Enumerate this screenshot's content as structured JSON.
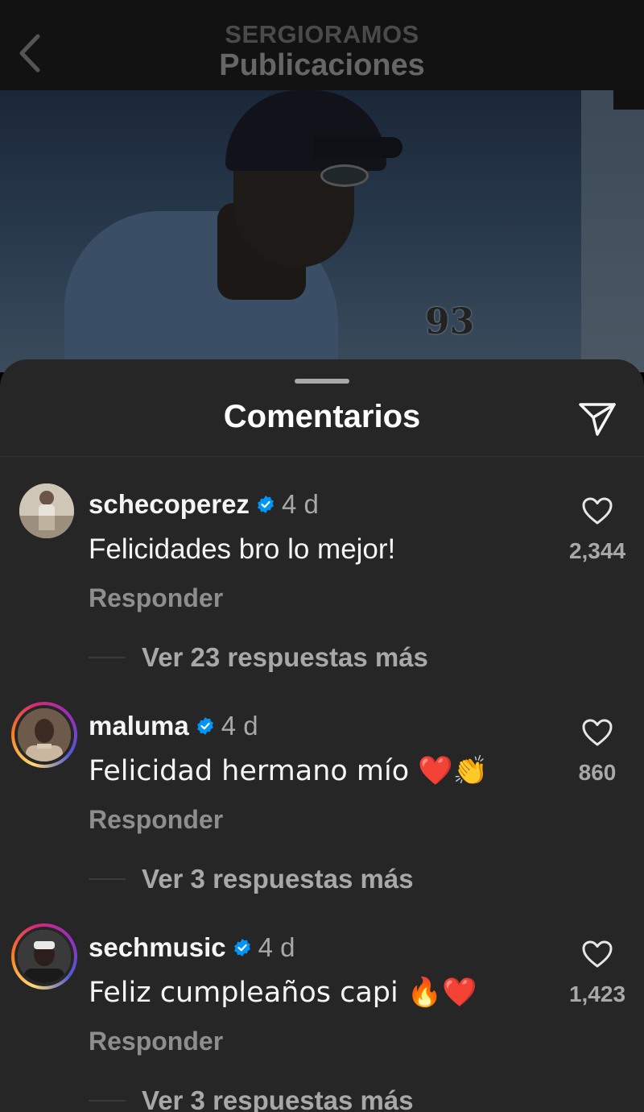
{
  "header": {
    "username": "SERGIORAMOS",
    "title": "Publicaciones",
    "back_icon": "chevron-left-icon"
  },
  "sheet": {
    "title": "Comentarios",
    "share_icon": "paper-plane-icon"
  },
  "comments": [
    {
      "username": "schecoperez",
      "verified": true,
      "time": "4 d",
      "text": "Felicidades bro lo mejor!",
      "reply_label": "Responder",
      "more_replies": "Ver 23 respuestas más",
      "likes": "2,344"
    },
    {
      "username": "maluma",
      "verified": true,
      "time": "4 d",
      "text": "Felicidad hermano mío ❤️👏",
      "reply_label": "Responder",
      "more_replies": "Ver 3 respuestas más",
      "likes": "860"
    },
    {
      "username": "sechmusic",
      "verified": true,
      "time": "4 d",
      "text": "Feliz cumpleaños capi 🔥❤️",
      "reply_label": "Responder",
      "more_replies": "Ver 3 respuestas más",
      "likes": "1,423"
    }
  ],
  "post_image": {
    "cake_topper": "93"
  },
  "colors": {
    "sheet_bg": "#262626",
    "verified_blue": "#0095f6",
    "secondary_text": "#a8a8a8"
  }
}
